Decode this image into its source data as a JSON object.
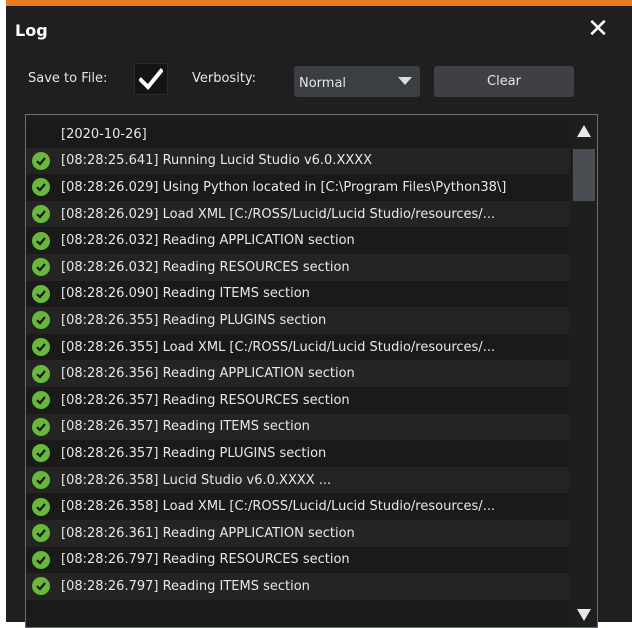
{
  "window": {
    "title": "Log",
    "accent_color": "#e97b22",
    "close_icon": "close-icon"
  },
  "toolbar": {
    "save_to_file_label": "Save to File:",
    "save_to_file_checked": true,
    "verbosity_label": "Verbosity:",
    "verbosity_value": "Normal",
    "clear_label": "Clear"
  },
  "log": {
    "status_icon": "check-circle-icon",
    "status_color": "#67b83b",
    "entries": [
      {
        "text": "[2020-10-26]",
        "status": "none"
      },
      {
        "text": "[08:28:25.641] Running Lucid Studio v6.0.XXXX",
        "status": "ok"
      },
      {
        "text": "[08:28:26.029] Using Python located in [C:\\Program Files\\Python38\\]",
        "status": "ok"
      },
      {
        "text": "[08:28:26.029] Load XML [C:/ROSS/Lucid/Lucid Studio/resources/...",
        "status": "ok"
      },
      {
        "text": "[08:28:26.032] Reading APPLICATION section",
        "status": "ok"
      },
      {
        "text": "[08:28:26.032] Reading RESOURCES section",
        "status": "ok"
      },
      {
        "text": "[08:28:26.090] Reading ITEMS section",
        "status": "ok"
      },
      {
        "text": "[08:28:26.355] Reading PLUGINS section",
        "status": "ok"
      },
      {
        "text": "[08:28:26.355] Load XML [C:/ROSS/Lucid/Lucid Studio/resources/...",
        "status": "ok"
      },
      {
        "text": "[08:28:26.356] Reading APPLICATION section",
        "status": "ok"
      },
      {
        "text": "[08:28:26.357] Reading RESOURCES section",
        "status": "ok"
      },
      {
        "text": "[08:28:26.357] Reading ITEMS section",
        "status": "ok"
      },
      {
        "text": "[08:28:26.357] Reading PLUGINS section",
        "status": "ok"
      },
      {
        "text": "[08:28:26.358] Lucid Studio v6.0.XXXX ...",
        "status": "ok"
      },
      {
        "text": "[08:28:26.358] Load XML [C:/ROSS/Lucid/Lucid Studio/resources/...",
        "status": "ok"
      },
      {
        "text": "[08:28:26.361] Reading APPLICATION section",
        "status": "ok"
      },
      {
        "text": "[08:28:26.797] Reading RESOURCES section",
        "status": "ok"
      },
      {
        "text": "[08:28:26.797] Reading ITEMS section",
        "status": "ok"
      },
      {
        "text": "",
        "status": "none"
      }
    ]
  }
}
